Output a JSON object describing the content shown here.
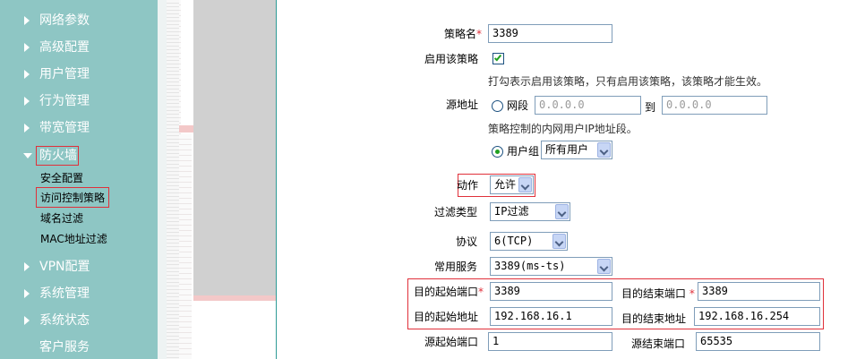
{
  "sidebar": {
    "items": [
      {
        "label": "网络参数"
      },
      {
        "label": "高级配置"
      },
      {
        "label": "用户管理"
      },
      {
        "label": "行为管理"
      },
      {
        "label": "带宽管理"
      },
      {
        "label": "防火墙"
      },
      {
        "label": "VPN配置"
      },
      {
        "label": "系统管理"
      },
      {
        "label": "系统状态"
      },
      {
        "label": "客户服务"
      }
    ],
    "firewall_sub": [
      "安全配置",
      "访问控制策略",
      "域名过滤",
      "MAC地址过滤"
    ]
  },
  "form": {
    "policy_name_label": "策略名",
    "required_mark": "*",
    "policy_name_value": "3389",
    "enable_label": "启用该策略",
    "enable_hint": "打勾表示启用该策略，只有启用该策略，该策略才能生效。",
    "source_addr_label": "源地址",
    "segment_label": "网段",
    "segment_from": "0.0.0.0",
    "to_label": "到",
    "segment_to": "0.0.0.0",
    "source_hint": "策略控制的内网用户IP地址段。",
    "user_group_label": "用户组",
    "user_group_value": "所有用户",
    "action_label": "动作",
    "action_value": "允许",
    "filter_type_label": "过滤类型",
    "filter_type_value": "IP过滤",
    "protocol_label": "协议",
    "protocol_value": "6(TCP)",
    "common_service_label": "常用服务",
    "common_service_value": "3389(ms-ts)",
    "dst_start_port_label": "目的起始端口",
    "dst_start_port_value": "3389",
    "dst_end_port_label": "目的结束端口",
    "dst_end_port_value": "3389",
    "dst_start_addr_label": "目的起始地址",
    "dst_start_addr_value": "192.168.16.1",
    "dst_end_addr_label": "目的结束地址",
    "dst_end_addr_value": "192.168.16.254",
    "src_start_port_label": "源起始端口",
    "src_start_port_value": "1",
    "src_end_port_label": "源结束端口",
    "src_end_port_value": "65535"
  },
  "colors": {
    "sidebar_bg": "#8ec6c4",
    "highlight_red": "#e0303a",
    "check_green": "#21a121"
  }
}
